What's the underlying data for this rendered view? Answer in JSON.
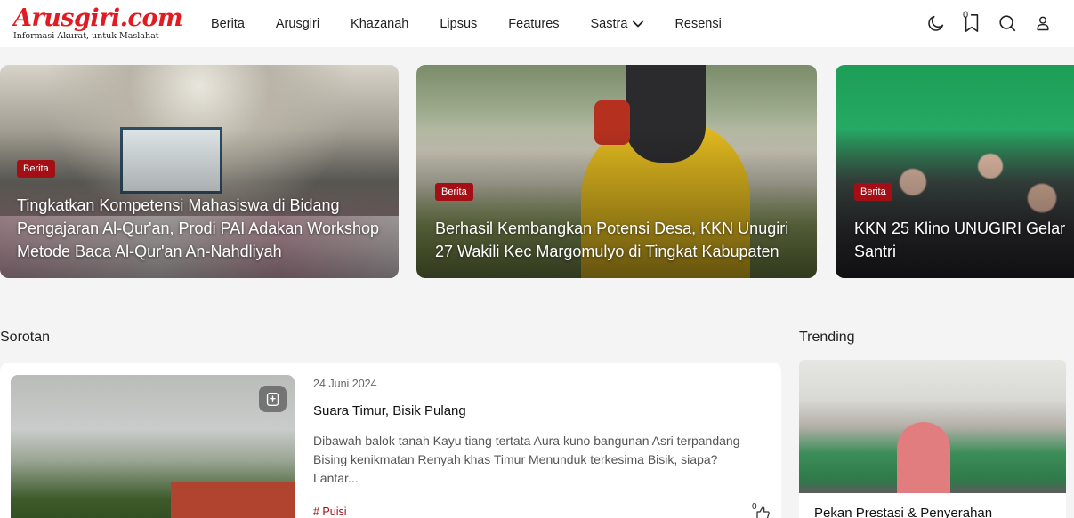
{
  "brand": {
    "name": "Arusgiri",
    "suffix": ".com",
    "tagline": "Informasi Akurat, untuk Maslahat",
    "accent": "#e01b22"
  },
  "nav": {
    "items": [
      {
        "label": "Berita"
      },
      {
        "label": "Arusgiri"
      },
      {
        "label": "Khazanah"
      },
      {
        "label": "Lipsus"
      },
      {
        "label": "Features"
      },
      {
        "label": "Sastra",
        "has_dropdown": true
      },
      {
        "label": "Resensi"
      }
    ]
  },
  "header_icons": {
    "dark_mode": "moon-icon",
    "bookmarks": "bookmark-icon",
    "bookmark_count": "0",
    "search": "search-icon",
    "account": "user-icon"
  },
  "slider": {
    "cards": [
      {
        "category": "Berita",
        "title": "Tingkatkan Kompetensi Mahasiswa di Bidang Pengajaran Al-Qur'an, Prodi PAI Adakan Workshop Metode Baca Al-Qur'an An-Nahdliyah"
      },
      {
        "category": "Berita",
        "title": "Berhasil Kembangkan Potensi Desa, KKN Unugiri 27 Wakili Kec Margomulyo di Tingkat Kabupaten"
      },
      {
        "category": "Berita",
        "title": "KKN 25 Klino UNUGIRI Gelar Santri"
      }
    ],
    "category_color": "#a30f14"
  },
  "sorotan": {
    "heading": "Sorotan",
    "post": {
      "date": "24 Juni 2024",
      "title": "Suara Timur, Bisik Pulang",
      "excerpt": "Dibawah balok tanah Kayu tiang tertata Aura kuno bangunan Asri terpandang Bising kenikmatan Renyah khas Timur Menunduk terkesima Bisik, siapa? Lantar...",
      "tag": "# Puisi",
      "like_count": "0"
    }
  },
  "trending": {
    "heading": "Trending",
    "post": {
      "title": "Pekan Prestasi & Penyerahan"
    }
  }
}
